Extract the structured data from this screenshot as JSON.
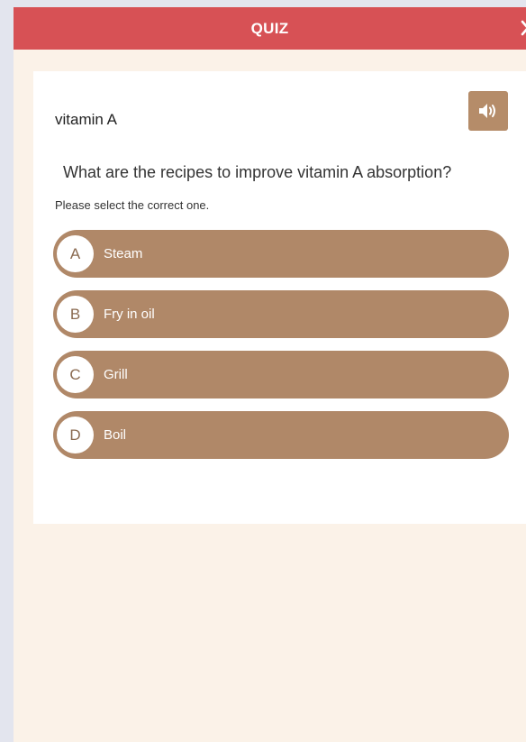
{
  "header": {
    "title": "QUIZ",
    "close_icon": "close-icon"
  },
  "quiz": {
    "subject": "vitamin A",
    "audio_icon": "speaker-icon",
    "question": "What are the recipes to improve vitamin A absorption?",
    "instruction": "Please select the correct one.",
    "options": [
      {
        "letter": "A",
        "label": "Steam"
      },
      {
        "letter": "B",
        "label": "Fry in oil"
      },
      {
        "letter": "C",
        "label": "Grill"
      },
      {
        "letter": "D",
        "label": "Boil"
      }
    ]
  },
  "colors": {
    "header": "#d75155",
    "background": "#fbf2e8",
    "option": "#b08868",
    "audio_button": "#b58c69"
  }
}
